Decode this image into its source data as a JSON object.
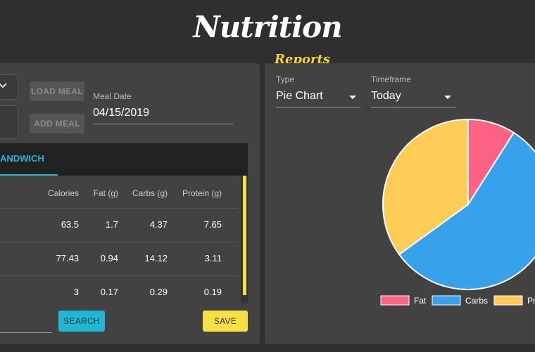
{
  "header": {
    "title": "Nutrition",
    "subtitle": "Reports"
  },
  "meal_panel": {
    "load_meal_label": "LOAD MEAL",
    "add_meal_label": "ADD MEAL",
    "meal_date_label": "Meal Date",
    "meal_date_value": "04/15/2019",
    "tab_label": "ANDWICH",
    "columns": [
      "Calories",
      "Fat (g)",
      "Carbs (g)",
      "Protein (g)"
    ],
    "rows": [
      [
        "63.5",
        "1.7",
        "4.37",
        "7.65"
      ],
      [
        "77.43",
        "0.94",
        "14.12",
        "3.11"
      ],
      [
        "3",
        "0.17",
        "0.29",
        "0.19"
      ]
    ],
    "search_label": "SEARCH",
    "save_label": "SAVE"
  },
  "reports_panel": {
    "type_label": "Type",
    "type_value": "Pie Chart",
    "timeframe_label": "Timeframe",
    "timeframe_value": "Today"
  },
  "colors": {
    "accent_cyan": "#21b6d1",
    "accent_yellow": "#f5e142",
    "fat": "#ff6384",
    "carbs": "#36a2eb",
    "protein": "#ffcd56"
  },
  "chart_data": {
    "type": "pie",
    "title": "",
    "categories": [
      "Fat",
      "Carbs",
      "Pr"
    ],
    "values": [
      9,
      56,
      35
    ],
    "legend_placement": "bottom"
  }
}
